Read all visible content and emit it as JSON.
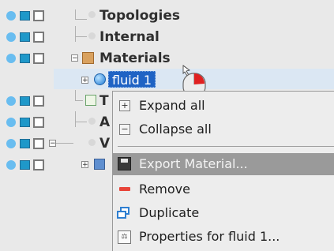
{
  "tree": {
    "items": [
      {
        "label": "Topologies",
        "icon": "dot-icon"
      },
      {
        "label": "Internal",
        "icon": "dot-icon"
      },
      {
        "label": "Materials",
        "icon": "materials-box-icon"
      },
      {
        "label": "fluid 1",
        "icon": "fluid-sphere-icon"
      },
      {
        "label": "T",
        "icon": "table-icon"
      },
      {
        "label": "A",
        "icon": "dot-icon"
      },
      {
        "label": "V",
        "icon": "dot-icon"
      }
    ]
  },
  "context_menu": {
    "items": [
      {
        "label": "Expand all",
        "icon": "expand-icon",
        "enabled": true
      },
      {
        "label": "Collapse all",
        "icon": "collapse-icon",
        "enabled": true
      },
      {
        "label": "Export Material...",
        "icon": "floppy-disk-icon",
        "enabled": false
      },
      {
        "label": "Remove",
        "icon": "remove-icon",
        "enabled": true
      },
      {
        "label": "Duplicate",
        "icon": "duplicate-icon",
        "enabled": true
      },
      {
        "label": "Properties for fluid 1...",
        "icon": "properties-icon",
        "enabled": true
      }
    ]
  },
  "colors": {
    "selection": "#1f63c4",
    "eye": "#69bdf0",
    "accent_square": "#1f98c9",
    "menu_bg": "#ededed",
    "menu_highlight": "#9a9a9a"
  }
}
